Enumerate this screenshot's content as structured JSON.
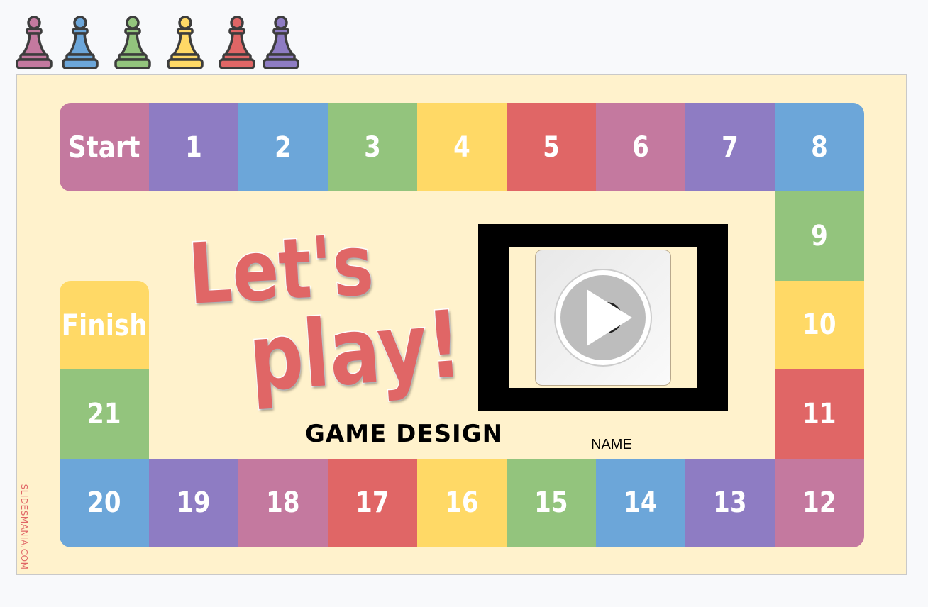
{
  "pawns": [
    {
      "color": "#c4799f",
      "icon": "pawn-icon"
    },
    {
      "color": "#6ca6d9",
      "icon": "pawn-icon"
    },
    {
      "color": "#93c47d",
      "icon": "pawn-icon"
    },
    {
      "color": "#ffd966",
      "icon": "pawn-icon"
    },
    {
      "color": "#e06666",
      "icon": "pawn-icon"
    },
    {
      "color": "#8e7cc3",
      "icon": "pawn-icon"
    }
  ],
  "board": {
    "cells": [
      {
        "label": "Start",
        "color": "#c4799f"
      },
      {
        "label": "1",
        "color": "#8e7cc3"
      },
      {
        "label": "2",
        "color": "#6ca6d9"
      },
      {
        "label": "3",
        "color": "#93c47d"
      },
      {
        "label": "4",
        "color": "#ffd966"
      },
      {
        "label": "5",
        "color": "#e06666"
      },
      {
        "label": "6",
        "color": "#c4799f"
      },
      {
        "label": "7",
        "color": "#8e7cc3"
      },
      {
        "label": "8",
        "color": "#6ca6d9"
      },
      {
        "label": "9",
        "color": "#93c47d"
      },
      {
        "label": "10",
        "color": "#ffd966"
      },
      {
        "label": "11",
        "color": "#e06666"
      },
      {
        "label": "12",
        "color": "#c4799f"
      },
      {
        "label": "13",
        "color": "#8e7cc3"
      },
      {
        "label": "14",
        "color": "#6ca6d9"
      },
      {
        "label": "15",
        "color": "#93c47d"
      },
      {
        "label": "16",
        "color": "#ffd966"
      },
      {
        "label": "17",
        "color": "#e06666"
      },
      {
        "label": "18",
        "color": "#c4799f"
      },
      {
        "label": "19",
        "color": "#8e7cc3"
      },
      {
        "label": "20",
        "color": "#6ca6d9"
      },
      {
        "label": "21",
        "color": "#93c47d"
      },
      {
        "label": "Finish",
        "color": "#ffd966"
      }
    ]
  },
  "title": {
    "line1": "Let's",
    "line2": "play!",
    "color": "#e06666"
  },
  "subtitle": "GAME  DESIGN",
  "name_label": "NAME",
  "video": {
    "icon": "play-icon"
  },
  "watermark": "SLIDESMANIA.COM"
}
